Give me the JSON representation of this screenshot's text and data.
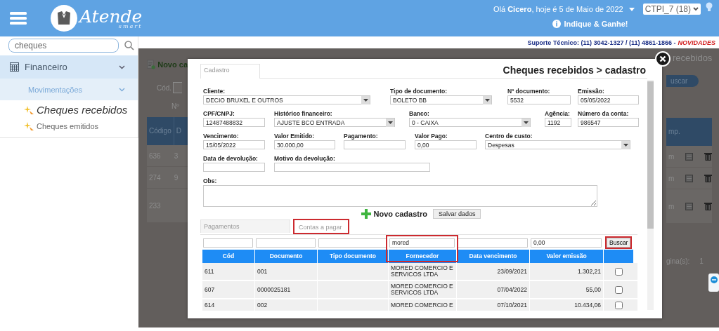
{
  "header": {
    "logo_text": "Atende",
    "logo_subtext": "smart",
    "greeting": "Olá **Cicero**, hoje é 5 de Maio de 2022",
    "company_select": "CTPI_7 (18)",
    "referral_link": "Indique & Ganhe!"
  },
  "sidebar": {
    "search": {
      "value": "cheques"
    },
    "items": [
      {
        "label": "Financeiro",
        "expanded": true,
        "children": [
          {
            "label": "Movimentações",
            "expanded": true,
            "children": [
              {
                "label": "Cheques recebidos",
                "selected": true
              },
              {
                "label": "Cheques emitidos",
                "selected": false
              }
            ]
          }
        ]
      }
    ]
  },
  "support_line": {
    "text": "Suporte Técnico: (11) 3042-1327 / (11) 4861-1866 -",
    "link": "NOVIDADES"
  },
  "background_page": {
    "left": {
      "new_link": "Novo ca",
      "code_label": "Cód.",
      "number_label": "Nº",
      "columns": [
        "Código",
        "D"
      ],
      "rows": [
        [
          "636",
          "3"
        ],
        [
          "274",
          "9"
        ],
        [
          "233",
          ""
        ]
      ]
    },
    "right": {
      "title": "recebidos",
      "search_button": "uscar",
      "columns": [
        "mp."
      ],
      "rows": [
        "m",
        "m",
        "m"
      ],
      "pages_label": "gina(s):",
      "pages_value": "1"
    }
  },
  "modal": {
    "tabs": [
      {
        "label": "Cadastro",
        "selected": true
      }
    ],
    "title": "Cheques recebidos > cadastro",
    "form_rows": [
      [
        {
          "label": "Cliente:",
          "value": "DECIO BRUXEL E OUTROS",
          "kind": "select"
        },
        {
          "label": "Tipo de documento:",
          "value": "BOLETO BB",
          "kind": "select"
        },
        {
          "label": "Nº documento:",
          "value": "5532",
          "kind": "text"
        },
        {
          "label": "Emissão:",
          "value": "05/05/2022",
          "kind": "text"
        }
      ],
      [
        {
          "label": "CPF/CNPJ:",
          "value": "12487488832",
          "kind": "text"
        },
        {
          "label": "Histórico financeiro:",
          "value": "AJUSTE BCO ENTRADA",
          "kind": "select"
        },
        {
          "label": "Banco:",
          "value": "0 - CAIXA",
          "kind": "select"
        },
        {
          "label": "Agência:",
          "value": "1192",
          "kind": "text"
        },
        {
          "label": "Número da conta:",
          "value": "986547",
          "kind": "text"
        }
      ],
      [
        {
          "label": "Vencimento:",
          "value": "15/05/2022",
          "kind": "text"
        },
        {
          "label": "Valor Emitido:",
          "value": "30.000,00",
          "kind": "text"
        },
        {
          "label": "Pagamento:",
          "kind": "text"
        },
        {
          "label": "Valor Pago:",
          "value": "0,00",
          "kind": "text"
        },
        {
          "label": "Centro de custo:",
          "value": "Despesas",
          "kind": "select"
        }
      ],
      [
        {
          "label": "Data de devolução:",
          "kind": "text"
        },
        {
          "label": "Motivo da devolução:",
          "kind": "text"
        }
      ],
      [
        {
          "label": "Obs:",
          "kind": "textarea"
        }
      ]
    ],
    "new_button": "Novo cadastro",
    "save_button": "Salvar dados",
    "lower_tabs": [
      {
        "label": "Pagamentos",
        "selected": false,
        "highlighted": false
      },
      {
        "label": "Contas a pagar",
        "selected": true,
        "highlighted": true
      }
    ],
    "filters": [
      {
        "kind": "text"
      },
      {
        "kind": "text"
      },
      {
        "kind": "text"
      },
      {
        "kind": "text",
        "value": "mored"
      },
      {
        "kind": "text"
      },
      {
        "kind": "text",
        "value": "0,00"
      }
    ],
    "search_button": {
      "label": "Buscar",
      "highlighted": true
    },
    "columns": [
      {
        "label": "Cód",
        "highlighted": false
      },
      {
        "label": "Documento",
        "highlighted": false
      },
      {
        "label": "Tipo documento",
        "highlighted": false
      },
      {
        "label": "Fornecedor",
        "highlighted": true
      },
      {
        "label": "Data vencimento",
        "highlighted": false
      },
      {
        "label": "Valor emissão",
        "highlighted": false
      }
    ],
    "rows": [
      {
        "cells": [
          "611",
          "001",
          "",
          "MORED COMERCIO E SERVICOS LTDA",
          "23/09/2021",
          "1.302,21"
        ],
        "checked": false
      },
      {
        "cells": [
          "607",
          "0000025181",
          "",
          "MORED COMERCIO E SERVICOS LTDA",
          "07/04/2022",
          "55,00"
        ],
        "checked": false
      },
      {
        "cells": [
          "614",
          "002",
          "",
          "MORED COMERCIO E",
          "07/10/2021",
          "10.434,06"
        ],
        "checked": false
      }
    ]
  }
}
